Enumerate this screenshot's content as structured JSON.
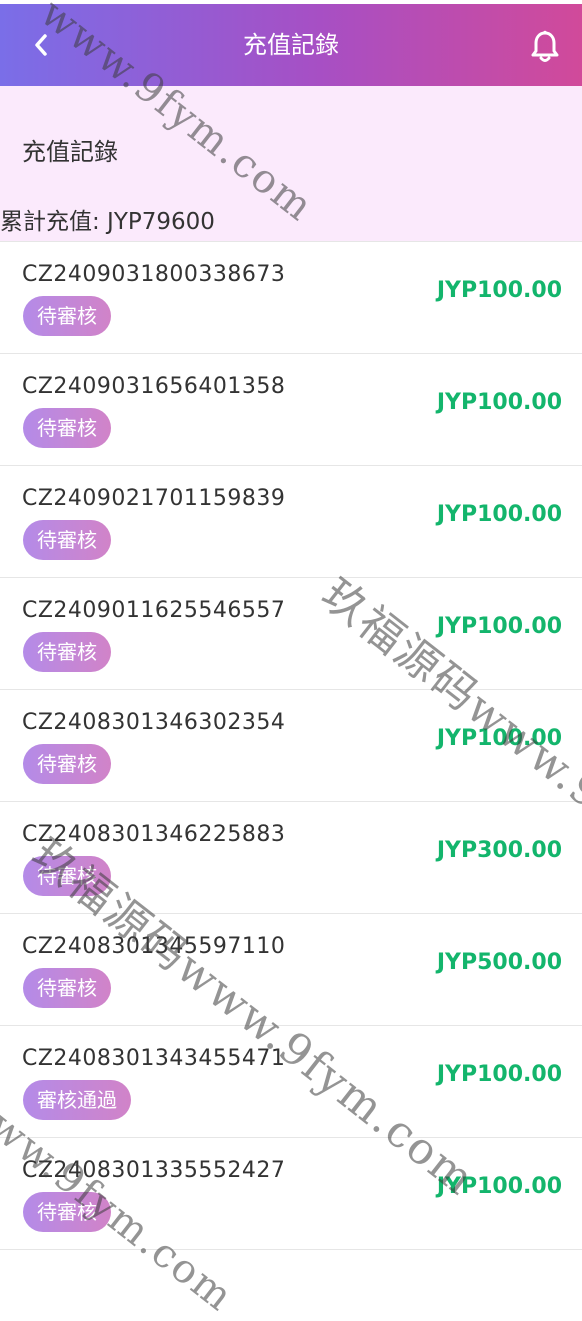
{
  "header": {
    "title": "充值記錄",
    "back_icon": "chevron-left-icon",
    "notify_icon": "bell-icon"
  },
  "summary": {
    "heading": "充值記錄",
    "total": "累計充值: JYP79600"
  },
  "records": [
    {
      "order_no": "CZ2409031800338673",
      "status": "待審核",
      "amount": "JYP100.00"
    },
    {
      "order_no": "CZ2409031656401358",
      "status": "待審核",
      "amount": "JYP100.00"
    },
    {
      "order_no": "CZ2409021701159839",
      "status": "待審核",
      "amount": "JYP100.00"
    },
    {
      "order_no": "CZ2409011625546557",
      "status": "待審核",
      "amount": "JYP100.00"
    },
    {
      "order_no": "CZ2408301346302354",
      "status": "待審核",
      "amount": "JYP100.00"
    },
    {
      "order_no": "CZ2408301346225883",
      "status": "待審核",
      "amount": "JYP300.00"
    },
    {
      "order_no": "CZ2408301345597110",
      "status": "待審核",
      "amount": "JYP500.00"
    },
    {
      "order_no": "CZ2408301343455471",
      "status": "審核通過",
      "amount": "JYP100.00"
    },
    {
      "order_no": "CZ2408301335552427",
      "status": "待審核",
      "amount": "JYP100.00"
    }
  ],
  "watermark": {
    "text_a": "玖福源码www.9fym.com",
    "text_b": "www.9fym.com"
  },
  "colors": {
    "amount": "#13b56c",
    "header_start": "#7a6ee8",
    "header_end": "#d14a9a",
    "summary_bg": "#fbeafc"
  }
}
